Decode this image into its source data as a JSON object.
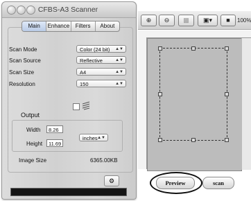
{
  "window": {
    "title": "CFBS-A3 Scanner"
  },
  "tabs": [
    {
      "label": "Main",
      "active": true
    },
    {
      "label": "Enhance",
      "active": false
    },
    {
      "label": "Filters",
      "active": false
    },
    {
      "label": "About",
      "active": false
    }
  ],
  "settings": {
    "scan_mode": {
      "label": "Scan Mode",
      "value": "Color (24 bit)"
    },
    "scan_source": {
      "label": "Scan Source",
      "value": "Reflective"
    },
    "scan_size": {
      "label": "Scan Size",
      "value": "A4"
    },
    "resolution": {
      "label": "Resolution",
      "value": "150"
    }
  },
  "output": {
    "heading": "Output",
    "width_label": "Width",
    "width_value": "8.26",
    "height_label": "Height",
    "height_value": "11.69",
    "unit": "inches"
  },
  "image_size": {
    "label": "Image Size",
    "value": "6365.00KB"
  },
  "toolbar": {
    "zoom_percent": "100%"
  },
  "preview_button": "Preview",
  "scan_button": "scan",
  "icons": {
    "zoom_in": "zoom-in-icon",
    "zoom_out": "zoom-out-icon",
    "settings": "gear-icon"
  }
}
